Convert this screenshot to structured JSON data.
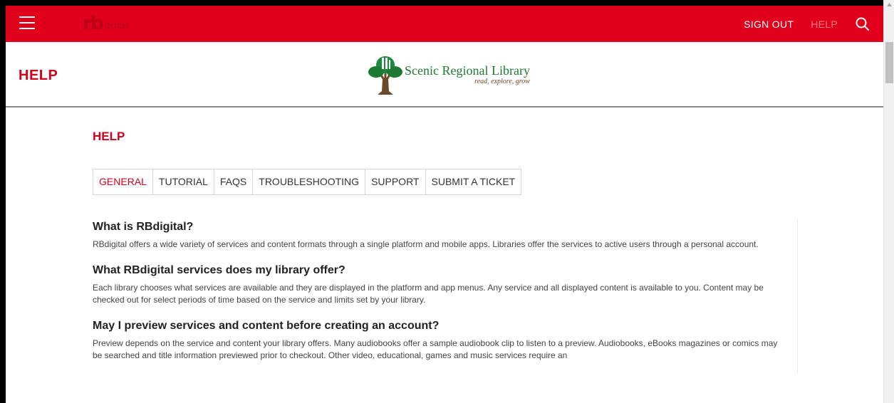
{
  "topbar": {
    "brand_mark": "rb",
    "brand_text": "digital",
    "sign_out_label": "SIGN OUT",
    "help_label": "HELP",
    "icons": {
      "menu": "hamburger-icon",
      "search": "search-icon"
    },
    "colors": {
      "background": "#e0001b",
      "link": "#ffffff",
      "link_dim": "#ff7b86"
    }
  },
  "header": {
    "title": "HELP",
    "logo": {
      "name": "Scenic Regional Library",
      "tagline": "read, explore, grow"
    },
    "colors": {
      "title": "#d5001b"
    }
  },
  "main": {
    "section_title": "HELP",
    "tabs": [
      {
        "label": "GENERAL",
        "active": true
      },
      {
        "label": "TUTORIAL",
        "active": false
      },
      {
        "label": "FAQS",
        "active": false
      },
      {
        "label": "TROUBLESHOOTING",
        "active": false
      },
      {
        "label": "SUPPORT",
        "active": false
      },
      {
        "label": "SUBMIT A TICKET",
        "active": false
      }
    ],
    "faqs": [
      {
        "question": "What is RBdigital?",
        "answer": "RBdigital offers a wide variety of services and content formats through a single platform and mobile apps. Libraries offer the services to active users through a personal account."
      },
      {
        "question": "What RBdigital services does my library offer?",
        "answer": "Each library chooses what services are available and they are displayed in the platform and app menus. Any service and all displayed content is available to you. Content may be checked out for select periods of time based on the service and limits set by your library."
      },
      {
        "question": "May I preview services and content before creating an account?",
        "answer": "Preview depends on the service and content your library offers. Many audiobooks offer a sample audiobook clip to listen to a preview. Audiobooks, eBooks magazines or comics may be searched and title information previewed prior to checkout. Other video, educational, games and music services require an"
      }
    ],
    "colors": {
      "accent": "#d5001b"
    }
  }
}
